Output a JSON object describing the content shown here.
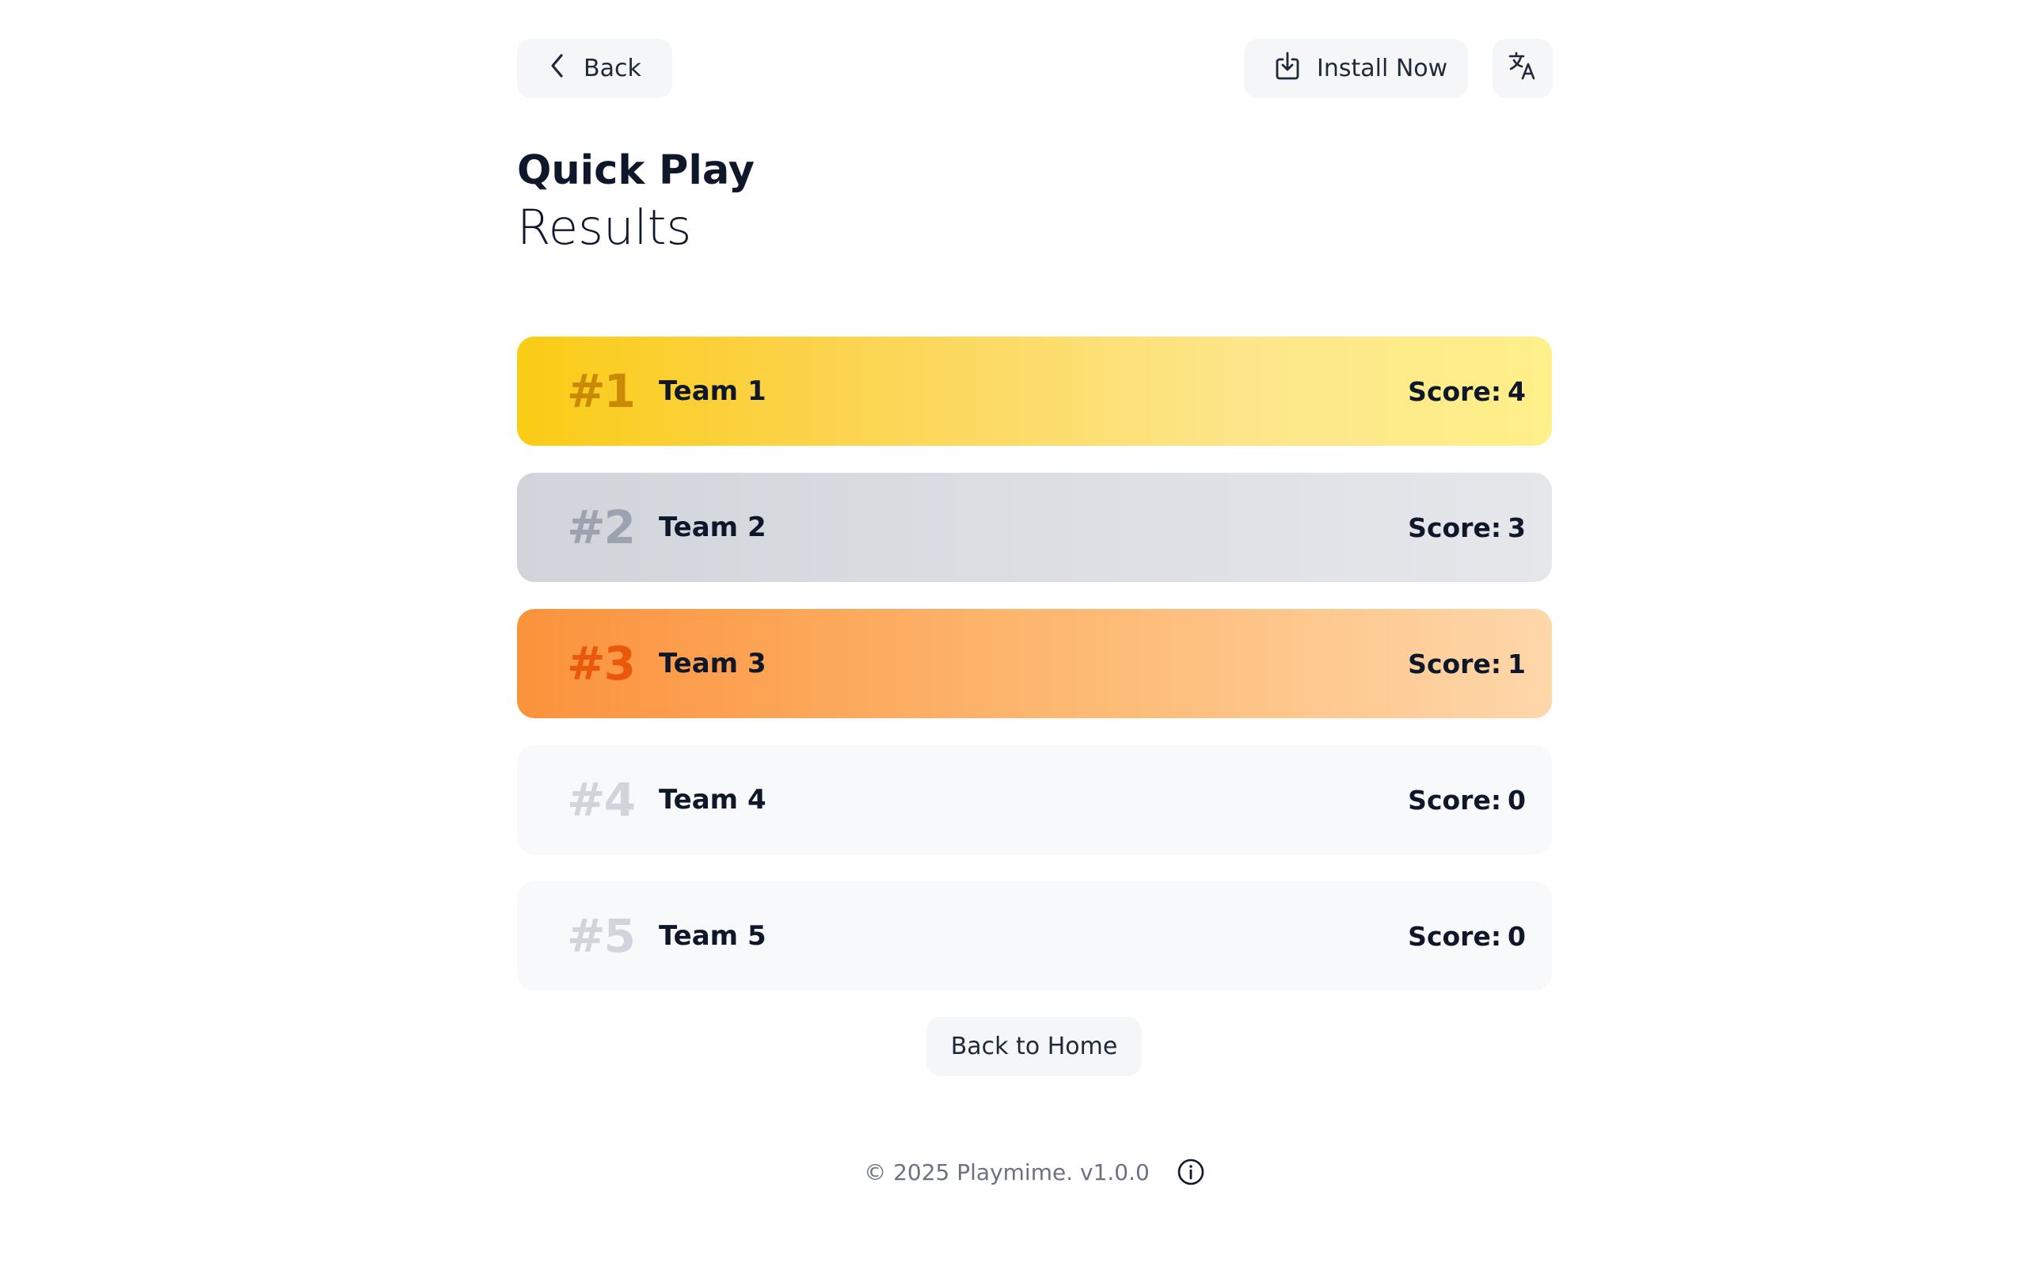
{
  "header": {
    "back_label": "Back",
    "install_label": "Install Now"
  },
  "title": {
    "line1": "Quick Play",
    "line2": "Results"
  },
  "results": [
    {
      "rank": "#1",
      "team": "Team 1",
      "score_label": "Score:",
      "score": "4"
    },
    {
      "rank": "#2",
      "team": "Team 2",
      "score_label": "Score:",
      "score": "3"
    },
    {
      "rank": "#3",
      "team": "Team 3",
      "score_label": "Score:",
      "score": "1"
    },
    {
      "rank": "#4",
      "team": "Team 4",
      "score_label": "Score:",
      "score": "0"
    },
    {
      "rank": "#5",
      "team": "Team 5",
      "score_label": "Score:",
      "score": "0"
    }
  ],
  "actions": {
    "home_label": "Back to Home"
  },
  "footer": {
    "text": "© 2025 Playmime. v1.0.0"
  },
  "icons": {
    "back": "chevron-left-icon",
    "install": "download-icon",
    "language": "translate-icon",
    "info": "info-icon"
  },
  "colors": {
    "gold": "#facc15",
    "silver": "#d1d5db",
    "bronze": "#fb923c",
    "neutral": "#f8f9fb"
  }
}
